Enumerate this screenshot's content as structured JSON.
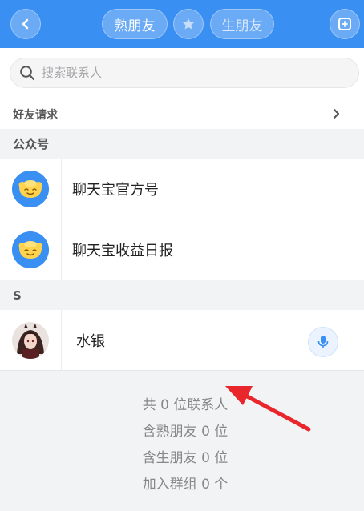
{
  "header": {
    "tab_familiar": "熟朋友",
    "tab_stranger": "生朋友",
    "colors": {
      "bar": "#3a8ff2",
      "text": "#ffffff"
    },
    "icons": {
      "back": "chevron-left-icon",
      "star": "star-icon",
      "scan": "scan-icon"
    }
  },
  "search": {
    "placeholder": "搜索联系人",
    "value": "",
    "icon": "search-icon"
  },
  "friend_requests": {
    "label": "好友请求",
    "icon": "chevron-right-icon"
  },
  "sections": {
    "official": {
      "title": "公众号",
      "items": [
        {
          "name": "聊天宝官方号",
          "avatar_icon": "gold-ingot-icon"
        },
        {
          "name": "聊天宝收益日报",
          "avatar_icon": "gold-ingot-icon"
        }
      ]
    },
    "s": {
      "title": "S",
      "items": [
        {
          "name": "水银",
          "avatar_icon": "user-avatar-photo",
          "action_icon": "microphone-icon"
        }
      ]
    }
  },
  "stats": {
    "total": "共 0 位联系人",
    "familiar": "含熟朋友 0 位",
    "stranger": "含生朋友 0 位",
    "groups": "加入群组 0 个"
  },
  "annotation": {
    "color": "#e8262b"
  }
}
